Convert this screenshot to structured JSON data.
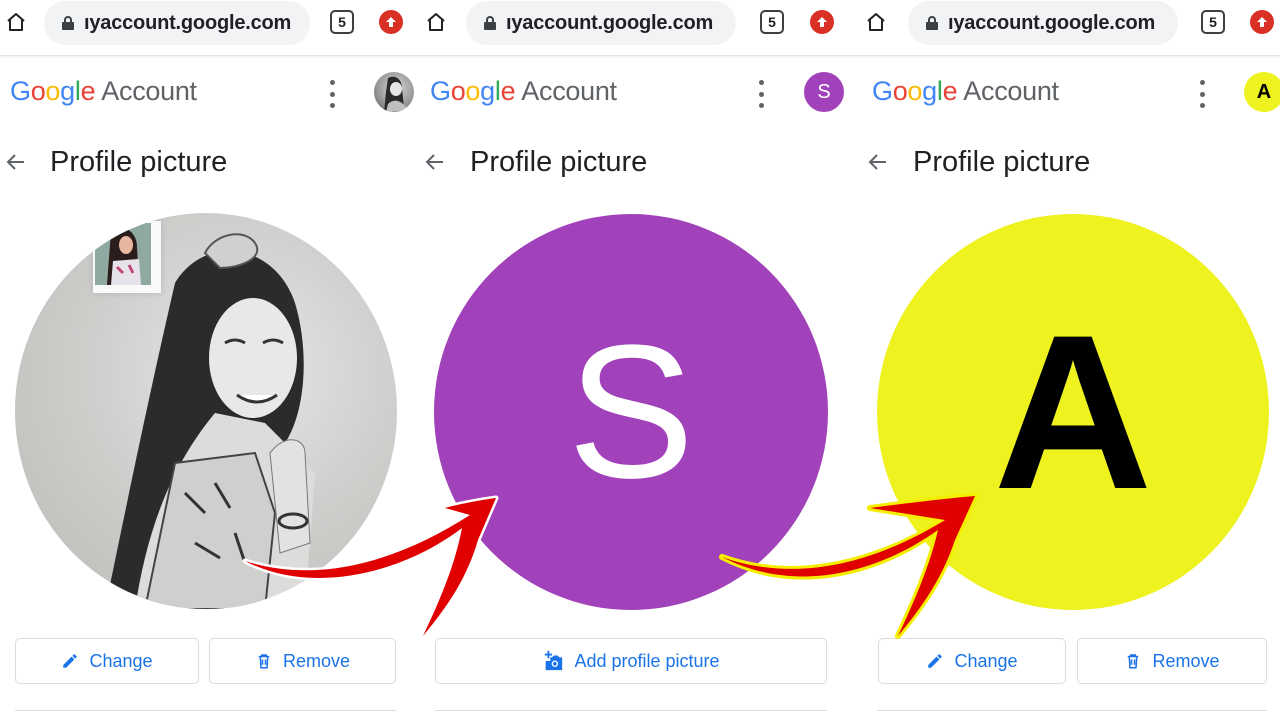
{
  "panels": [
    {
      "browser": {
        "url": "ıyaccount.google.com",
        "tab_count": "5"
      },
      "header": {
        "brand": [
          "G",
          "o",
          "o",
          "g",
          "l",
          "e"
        ],
        "product": "Account",
        "avatar_letter": "",
        "avatar_kind": "photo"
      },
      "page_title": "Profile picture",
      "profile": {
        "kind": "photo",
        "letter": ""
      },
      "buttons": [
        {
          "label": "Change",
          "icon": "pencil-icon"
        },
        {
          "label": "Remove",
          "icon": "trash-icon"
        }
      ]
    },
    {
      "browser": {
        "url": "ıyaccount.google.com",
        "tab_count": "5"
      },
      "header": {
        "brand": [
          "G",
          "o",
          "o",
          "g",
          "l",
          "e"
        ],
        "product": "Account",
        "avatar_letter": "S",
        "avatar_kind": "letter"
      },
      "page_title": "Profile picture",
      "profile": {
        "kind": "letter",
        "letter": "S"
      },
      "buttons": [
        {
          "label": "Add profile picture",
          "icon": "add-photo-icon"
        }
      ]
    },
    {
      "browser": {
        "url": "ıyaccount.google.com",
        "tab_count": "5"
      },
      "header": {
        "brand": [
          "G",
          "o",
          "o",
          "g",
          "l",
          "e"
        ],
        "product": "Account",
        "avatar_letter": "A",
        "avatar_kind": "letter"
      },
      "page_title": "Profile picture",
      "profile": {
        "kind": "letter",
        "letter": "A"
      },
      "buttons": [
        {
          "label": "Change",
          "icon": "pencil-icon"
        },
        {
          "label": "Remove",
          "icon": "trash-icon"
        }
      ]
    }
  ],
  "colors": {
    "google_blue": "#4285f4",
    "google_red": "#ea4335",
    "google_yellow": "#fbbc05",
    "google_green": "#34a853",
    "link_blue": "#1a73e8",
    "avatar_purple": "#a142bb",
    "avatar_yellow": "#eef21e",
    "arrow_red": "#e00000"
  }
}
